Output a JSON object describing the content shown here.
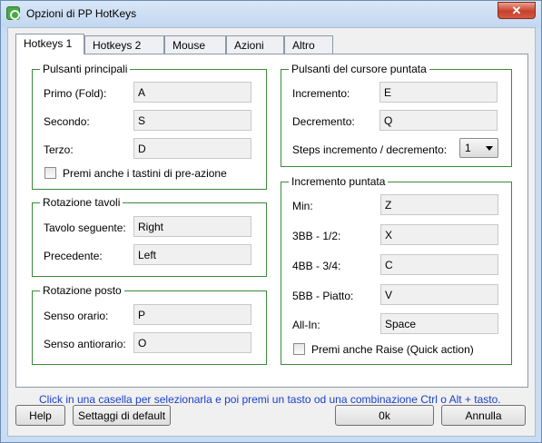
{
  "window": {
    "title": "Opzioni di PP HotKeys",
    "close_glyph": "✕",
    "accent": "#3a8a3a"
  },
  "tabs": [
    "Hotkeys 1",
    "Hotkeys 2",
    "Mouse",
    "Azioni",
    "Altro"
  ],
  "pulsanti_principali": {
    "title": "Pulsanti principali",
    "primo_label": "Primo (Fold):",
    "primo_value": "A",
    "secondo_label": "Secondo:",
    "secondo_value": "S",
    "terzo_label": "Terzo:",
    "terzo_value": "D",
    "checkbox_label": "Premi anche i tastini di pre-azione"
  },
  "rotazione_tavoli": {
    "title": "Rotazione tavoli",
    "seguente_label": "Tavolo seguente:",
    "seguente_value": "Right",
    "precedente_label": "Precedente:",
    "precedente_value": "Left"
  },
  "rotazione_posto": {
    "title": "Rotazione posto",
    "orario_label": "Senso orario:",
    "orario_value": "P",
    "antiorario_label": "Senso antiorario:",
    "antiorario_value": "O"
  },
  "cursore_puntata": {
    "title": "Pulsanti del cursore puntata",
    "incremento_label": "Incremento:",
    "incremento_value": "E",
    "decremento_label": "Decremento:",
    "decremento_value": "Q",
    "steps_label": "Steps incremento / decremento:",
    "steps_value": "1"
  },
  "incremento_puntata": {
    "title": "Incremento puntata",
    "min_label": "Min:",
    "min_value": "Z",
    "bb3_label": "3BB - 1/2:",
    "bb3_value": "X",
    "bb4_label": "4BB - 3/4:",
    "bb4_value": "C",
    "bb5_label": "5BB - Piatto:",
    "bb5_value": "V",
    "allin_label": "All-In:",
    "allin_value": "Space",
    "checkbox_label": "Premi anche Raise (Quick action)"
  },
  "hint": "Click in una casella per selezionarla e poi premi un tasto od  una combinazione Ctrl o Alt + tasto.",
  "buttons": {
    "help": "Help",
    "default": "Settaggi di default",
    "ok": "0k",
    "cancel": "Annulla"
  }
}
